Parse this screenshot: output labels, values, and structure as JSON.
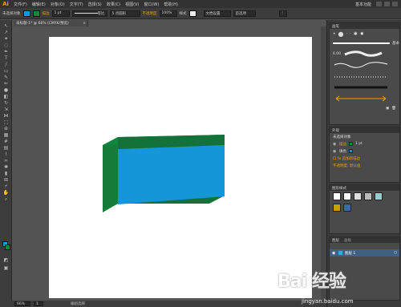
{
  "app": {
    "logo": "Ai"
  },
  "menu": [
    "文件(F)",
    "编辑(E)",
    "对象(O)",
    "文字(T)",
    "选择(S)",
    "效果(C)",
    "视图(V)",
    "窗口(W)",
    "帮助(H)"
  ],
  "workspace": "基本功能",
  "options": {
    "selection_label": "未选择对象",
    "stroke_label": "描边",
    "stroke_weight": "1 pt",
    "profile_label": "等比",
    "brush_label": "5 点圆形",
    "opacity_label": "不透明度",
    "opacity_value": "100%",
    "style_label": "样式",
    "doc_setup_button": "文档设置",
    "prefs_button": "首选项"
  },
  "doc_tab": "未标题-1* @ 66% (CMYK/预览)",
  "status": {
    "zoom": "66%",
    "page": "1",
    "tool": "编组选择"
  },
  "panels": {
    "brushes": {
      "title": "画笔",
      "library": "基本",
      "stroke_size": "6.00"
    },
    "appearance": {
      "title": "外观",
      "object": "未选择对象",
      "stroke_label": "描边",
      "stroke_value": "1 pt",
      "fill_label": "填色",
      "opacity_row": "不透明度: 默认值",
      "extra_row": "口 fx 追加新描边"
    },
    "graphic_styles": {
      "title": "图形样式"
    },
    "layers": {
      "title": "图层",
      "tab2": "画板",
      "layer_name": "图层 1"
    }
  },
  "colors": {
    "front_face": "#1596d8",
    "side_face": "#157c3a",
    "top_face": "#10883a",
    "accent": "#ff9a00"
  },
  "watermark": {
    "text": "Bai 经验",
    "url": "jingyan.baidu.com"
  }
}
